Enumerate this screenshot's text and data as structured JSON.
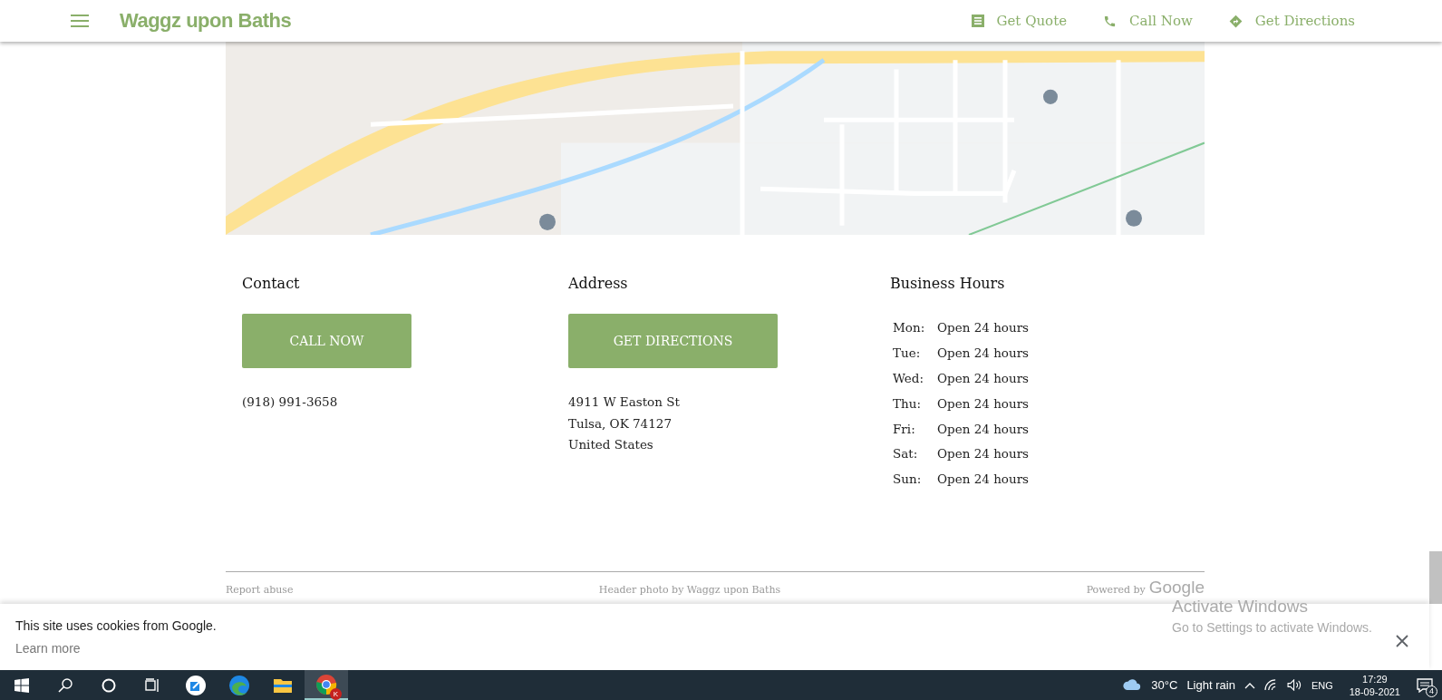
{
  "header": {
    "site_title": "Waggz upon Baths",
    "actions": [
      {
        "kind": "quote",
        "label": "Get Quote"
      },
      {
        "kind": "call",
        "label": "Call Now"
      },
      {
        "kind": "directions",
        "label": "Get Directions"
      }
    ]
  },
  "contact": {
    "heading": "Contact",
    "button": "CALL NOW",
    "phone": "(918) 991-3658"
  },
  "address": {
    "heading": "Address",
    "button": "GET DIRECTIONS",
    "lines": [
      "4911 W Easton St",
      "Tulsa, OK 74127",
      "United States"
    ]
  },
  "hours": {
    "heading": "Business Hours",
    "rows": [
      {
        "day": "Mon:",
        "time": "Open 24 hours"
      },
      {
        "day": "Tue:",
        "time": "Open 24 hours"
      },
      {
        "day": "Wed:",
        "time": "Open 24 hours"
      },
      {
        "day": "Thu:",
        "time": "Open 24 hours"
      },
      {
        "day": "Fri:",
        "time": "Open 24 hours"
      },
      {
        "day": "Sat:",
        "time": "Open 24 hours"
      },
      {
        "day": "Sun:",
        "time": "Open 24 hours"
      }
    ]
  },
  "footer": {
    "report": "Report abuse",
    "credit": "Header photo by Waggz upon Baths",
    "powered_by": "Powered by",
    "powered_logo": "Google"
  },
  "cookie_bar": {
    "message": "This site uses cookies from Google.",
    "link": "Learn more"
  },
  "activation_notice": {
    "title": "Activate Windows",
    "subtitle": "Go to Settings to activate Windows."
  },
  "taskbar": {
    "apps": [
      {
        "kind": "start",
        "selected": false
      },
      {
        "kind": "search",
        "selected": false
      },
      {
        "kind": "cortana",
        "selected": false
      },
      {
        "kind": "taskview",
        "selected": false
      },
      {
        "kind": "app",
        "selected": false
      },
      {
        "kind": "edge",
        "selected": false
      },
      {
        "kind": "files",
        "selected": false
      },
      {
        "kind": "chrome",
        "selected": true,
        "badge": "K"
      }
    ],
    "temperature": "30°C",
    "weather": "Light rain",
    "language": "ENG",
    "time": "17:29",
    "date": "18-09-2021",
    "notifications": "4"
  }
}
